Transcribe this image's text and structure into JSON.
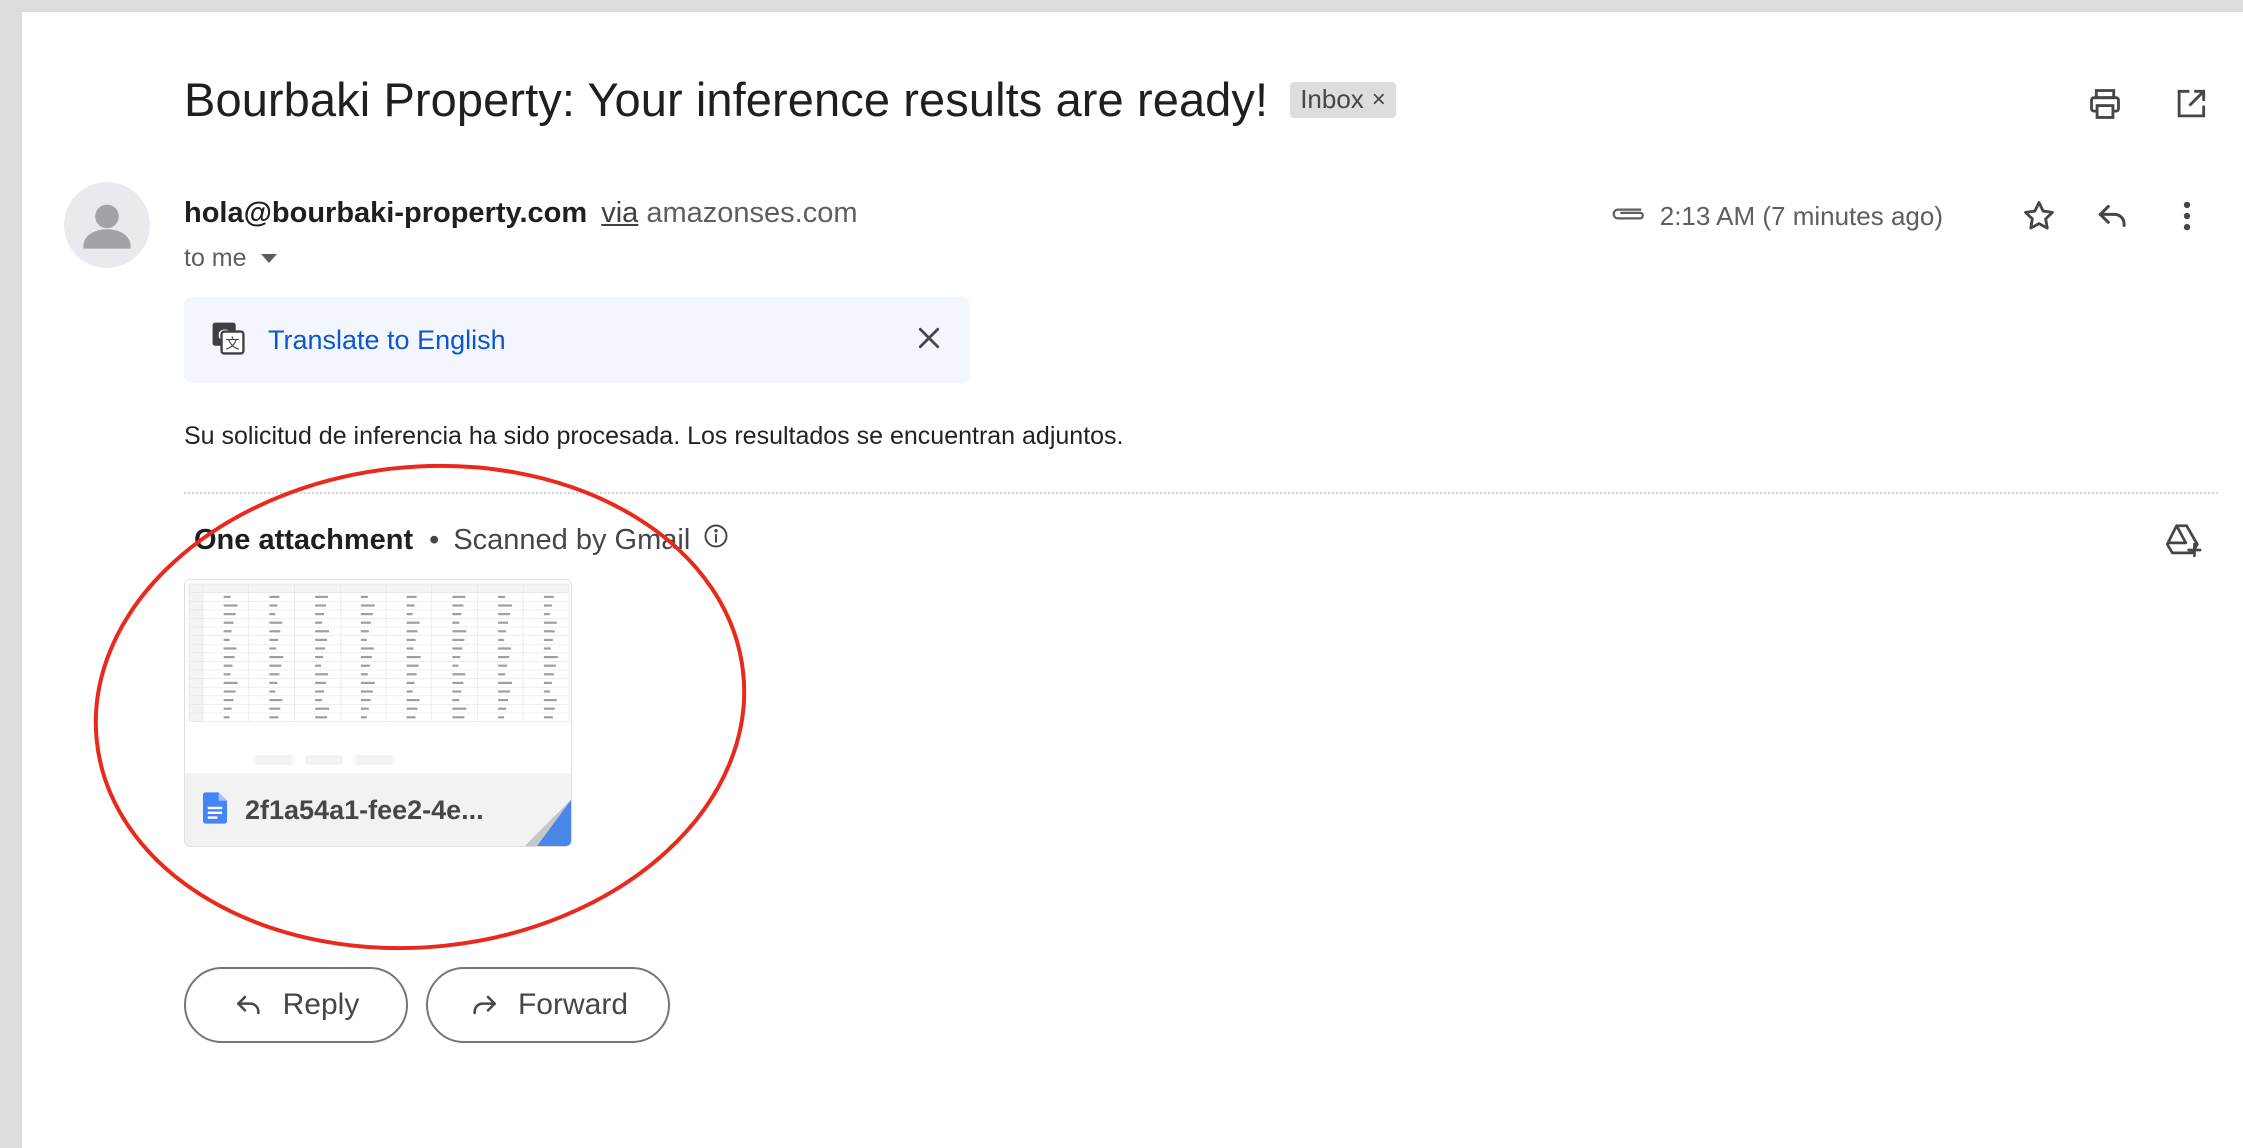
{
  "email": {
    "subject": "Bourbaki Property: Your inference results are ready!",
    "label_chip": "Inbox",
    "label_chip_close": "×",
    "sender_email": "hola@bourbaki-property.com",
    "via_text": "via",
    "via_domain": "amazonses.com",
    "recipient": "to me",
    "time": "2:13 AM (7 minutes ago)",
    "translate_label": "Translate to English",
    "body": "Su solicitud de inferencia ha sido procesada. Los resultados se encuentran adjuntos."
  },
  "attachments": {
    "title": "One attachment",
    "separator": "•",
    "scanned": "Scanned by Gmail",
    "files": [
      {
        "name": "2f1a54a1-fee2-4e..."
      }
    ]
  },
  "actions": {
    "reply_label": "Reply",
    "forward_label": "Forward"
  },
  "icons": [
    "print-icon",
    "open-in-new-window-icon",
    "attachment-clip-icon",
    "star-icon",
    "reply-icon",
    "more-vert-icon",
    "translate-icon",
    "close-icon",
    "info-icon",
    "add-to-drive-icon",
    "doc-icon",
    "forward-icon"
  ],
  "colors": {
    "link_blue": "#0b57d0",
    "annotation_red": "#e8291c",
    "doc_blue": "#4285f4"
  }
}
